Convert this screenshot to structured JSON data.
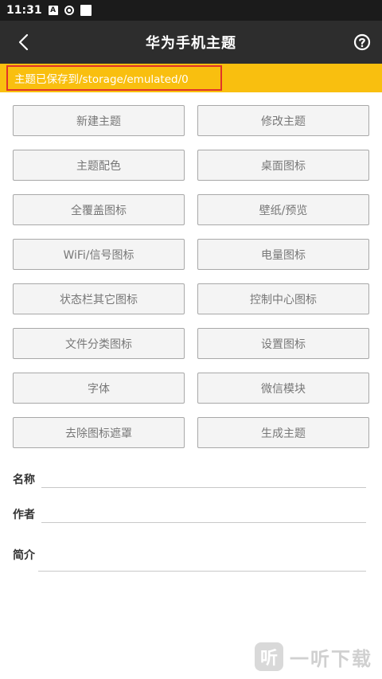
{
  "status_bar": {
    "time": "11:31",
    "icon_a": "A"
  },
  "toolbar": {
    "title": "华为手机主题"
  },
  "banner": {
    "text": "主题已保存到/storage/emulated/0"
  },
  "buttons": [
    {
      "label": "新建主题"
    },
    {
      "label": "修改主题"
    },
    {
      "label": "主题配色"
    },
    {
      "label": "桌面图标"
    },
    {
      "label": "全覆盖图标"
    },
    {
      "label": "壁纸/预览"
    },
    {
      "label": "WiFi/信号图标"
    },
    {
      "label": "电量图标"
    },
    {
      "label": "状态栏其它图标"
    },
    {
      "label": "控制中心图标"
    },
    {
      "label": "文件分类图标"
    },
    {
      "label": "设置图标"
    },
    {
      "label": "字体"
    },
    {
      "label": "微信模块"
    },
    {
      "label": "去除图标遮罩"
    },
    {
      "label": "生成主题"
    }
  ],
  "form": {
    "name_label": "名称",
    "name_value": "",
    "author_label": "作者",
    "author_value": "",
    "intro_label": "简介",
    "intro_value": ""
  },
  "watermark": {
    "mark": "听",
    "text": "一听下载"
  },
  "colors": {
    "banner": "#f9bf0f",
    "banner_border": "#e0342a",
    "toolbar": "#2d2d2d",
    "status_bar": "#1b1b1b"
  },
  "icons": [
    "back-arrow-icon",
    "help-icon"
  ]
}
